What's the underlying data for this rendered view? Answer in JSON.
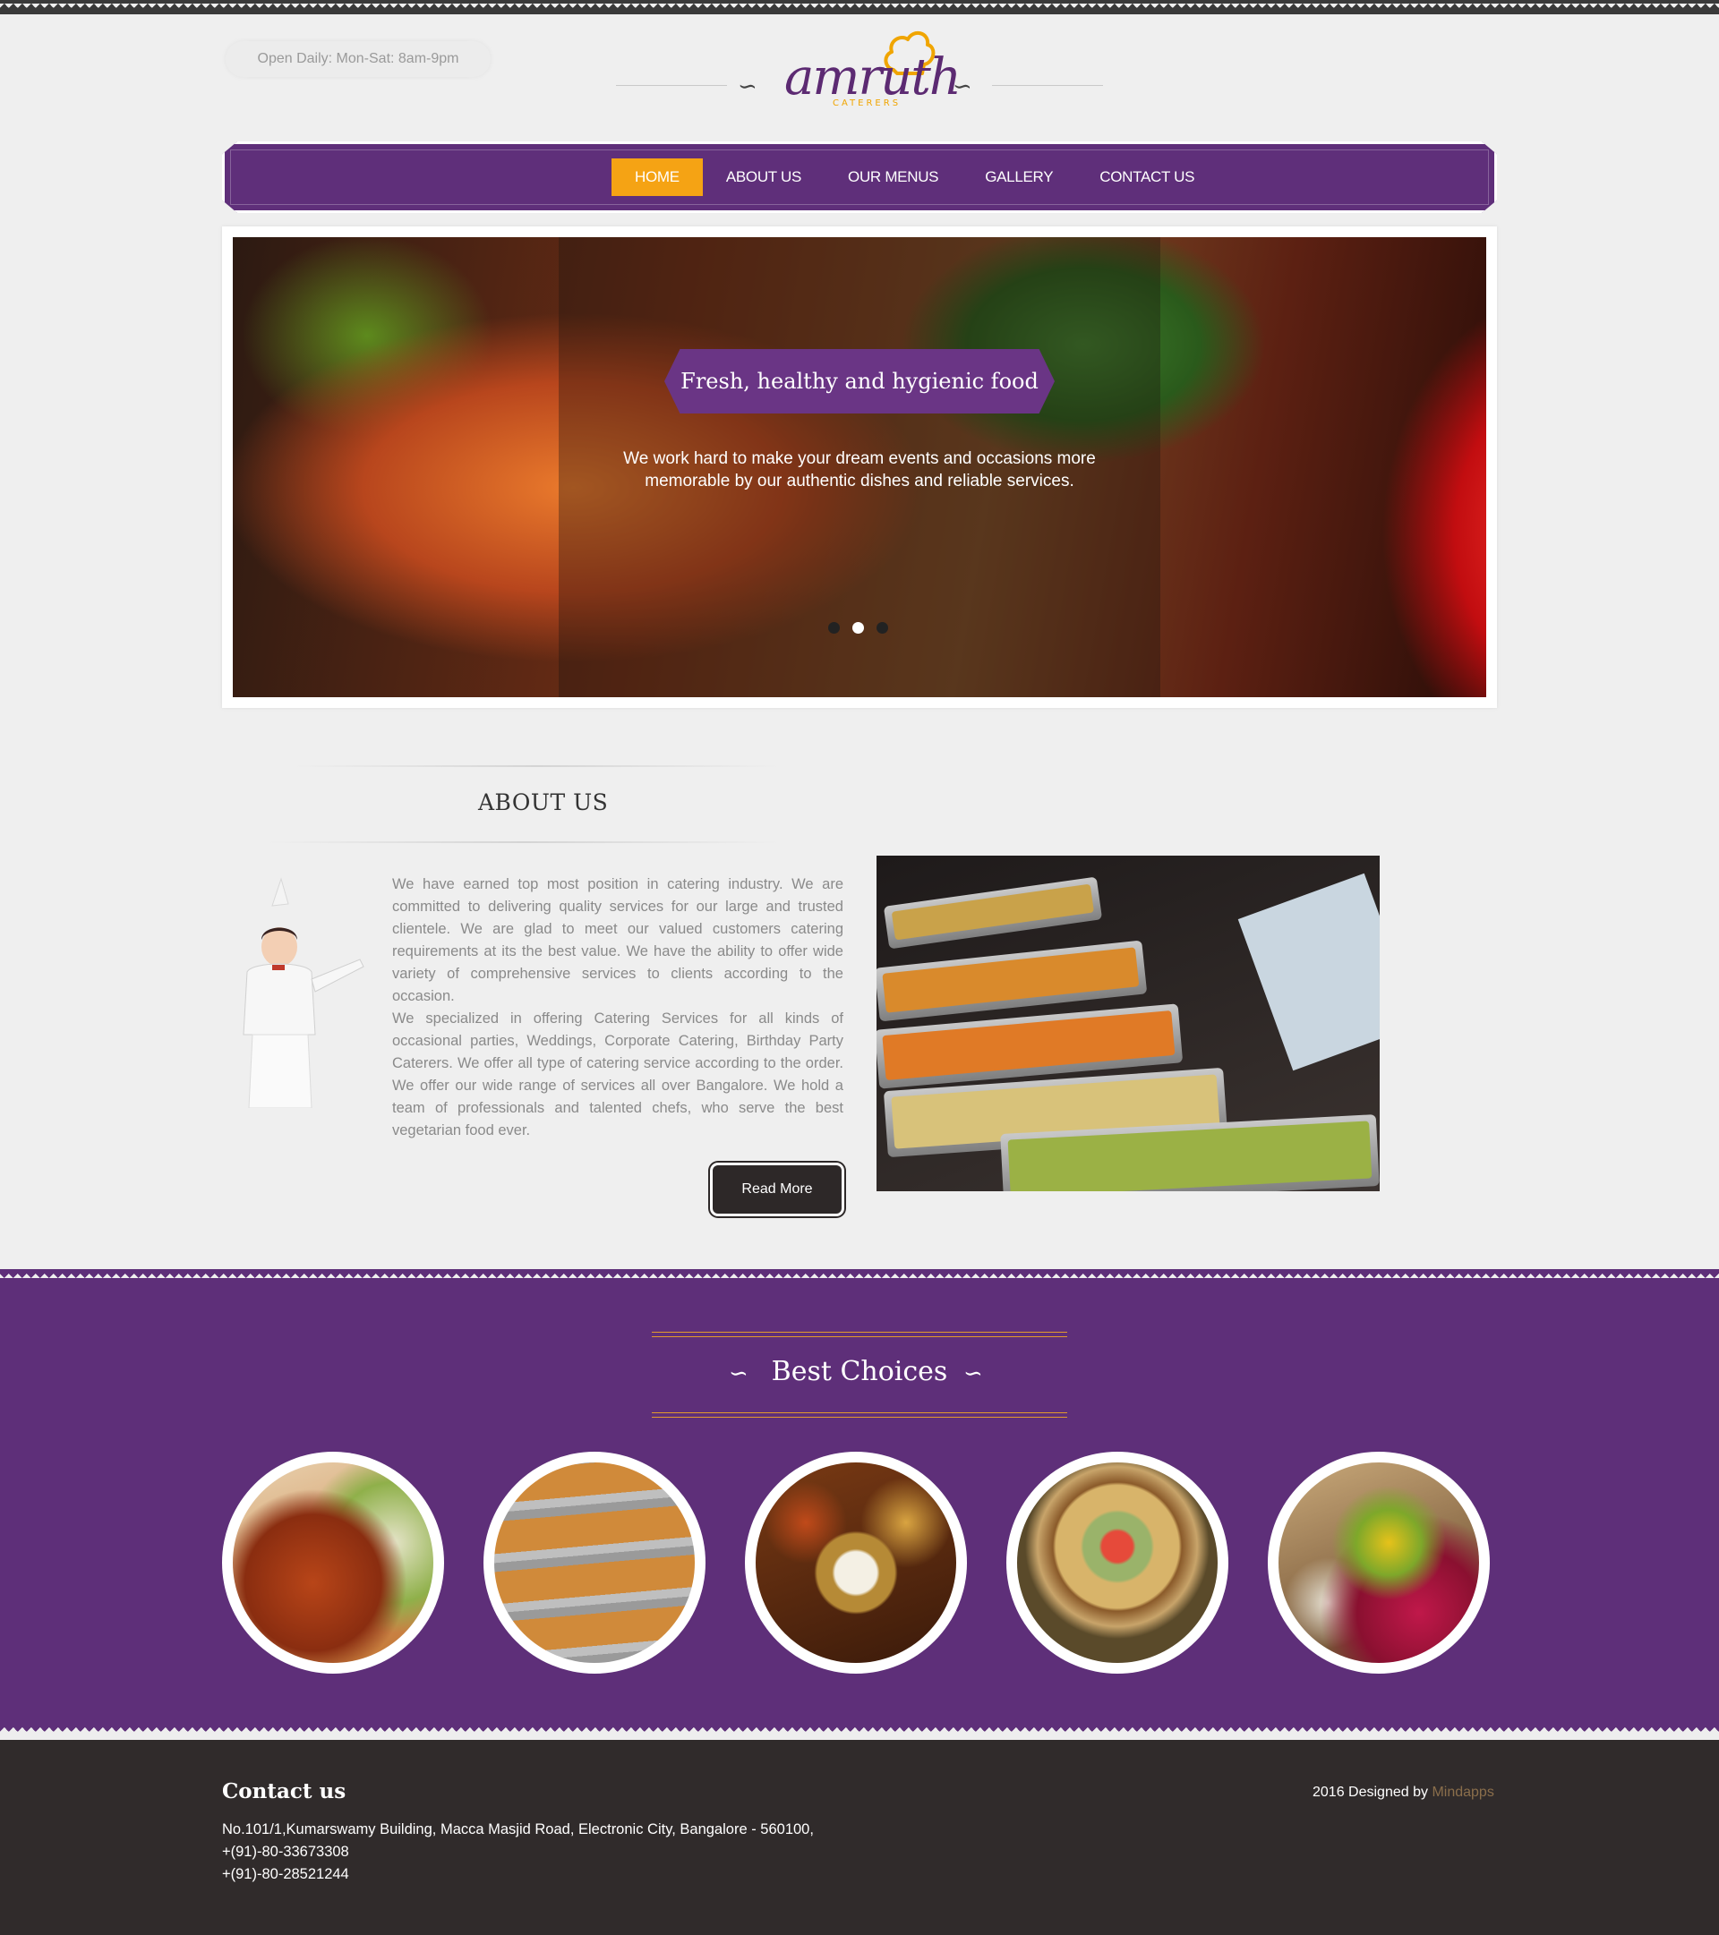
{
  "header": {
    "hours": "Open Daily: Mon-Sat: 8am-9pm",
    "logo_text": "amruth",
    "logo_sub": "CATERERS"
  },
  "nav": {
    "items": [
      {
        "label": "HOME",
        "active": true
      },
      {
        "label": "ABOUT US",
        "active": false
      },
      {
        "label": "OUR MENUS",
        "active": false
      },
      {
        "label": "GALLERY",
        "active": false
      },
      {
        "label": "CONTACT US",
        "active": false
      }
    ]
  },
  "slider": {
    "title": "Fresh, healthy and hygienic food",
    "text": "We work hard to make your dream events and occasions more memorable by our authentic dishes and reliable services.",
    "active_dot": 2,
    "dot_count": 3
  },
  "about": {
    "title": "ABOUT US",
    "paragraph1": "We have earned top most position in catering industry. We are committed to delivering quality services for our large and trusted clientele. We are glad to meet our valued customers catering requirements at its the best value. We have the ability to offer wide variety of comprehensive services to clients according to the occasion.",
    "paragraph2": "We specialized in offering Catering Services for all kinds of occasional parties, Weddings, Corporate Catering, Birthday Party Caterers. We offer all type of catering service according to the order. We offer our wide range of services all over Bangalore. We hold a team of professionals and talented chefs, who serve the best vegetarian food ever.",
    "read_more": "Read More"
  },
  "best_choices": {
    "title": "Best Choices"
  },
  "footer": {
    "title": "Contact us",
    "address": "No.101/1,Kumarswamy Building, Macca Masjid Road, Electronic City, Bangalore - 560100,",
    "phone1": "+(91)-80-33673308",
    "phone2": "+(91)-80-28521244",
    "credit_prefix": "2016 Designed by ",
    "credit_link": "Mindapps"
  },
  "colors": {
    "brand_purple": "#5e2f79",
    "accent_orange": "#f5a314",
    "footer_dark": "#302b2b"
  }
}
